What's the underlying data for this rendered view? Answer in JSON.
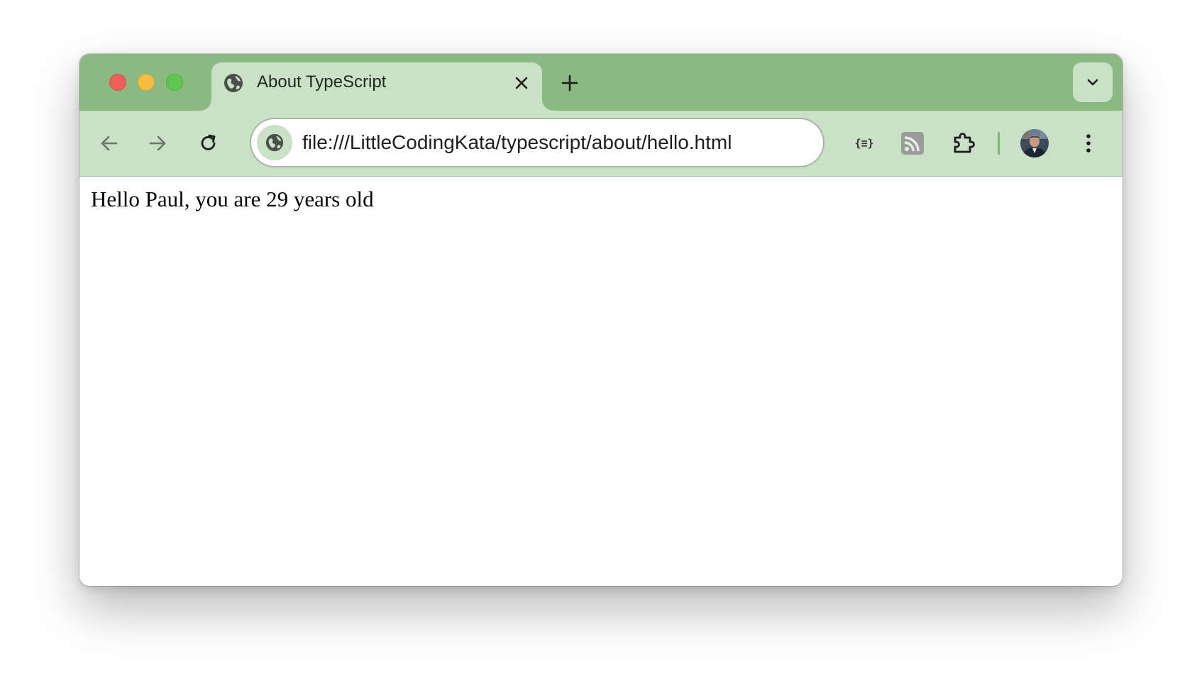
{
  "window": {
    "traffic_lights": [
      "close",
      "minimize",
      "maximize"
    ]
  },
  "tabs": [
    {
      "title": "About TypeScript",
      "favicon": "globe-icon",
      "active": true
    }
  ],
  "tabstrip": {
    "new_tab_icon": "plus-icon",
    "tab_search_icon": "chevron-down-icon"
  },
  "toolbar": {
    "back_icon": "arrow-left-icon",
    "forward_icon": "arrow-right-icon",
    "reload_icon": "reload-icon",
    "url": "file:///LittleCodingKata/typescript/about/hello.html",
    "site_info_icon": "globe-icon",
    "extensions": [
      {
        "name": "json-formatter",
        "label": "{≡}"
      },
      {
        "name": "rss-feed",
        "icon": "rss-icon"
      },
      {
        "name": "extensions-menu",
        "icon": "puzzle-icon"
      }
    ],
    "profile_icon": "avatar",
    "menu_icon": "kebab-menu-icon"
  },
  "page": {
    "text": "Hello Paul, you are 29 years old"
  },
  "colors": {
    "tabstrip_bg": "#8aba82",
    "toolbar_bg": "#c9e1c5",
    "divider": "#7db776"
  }
}
